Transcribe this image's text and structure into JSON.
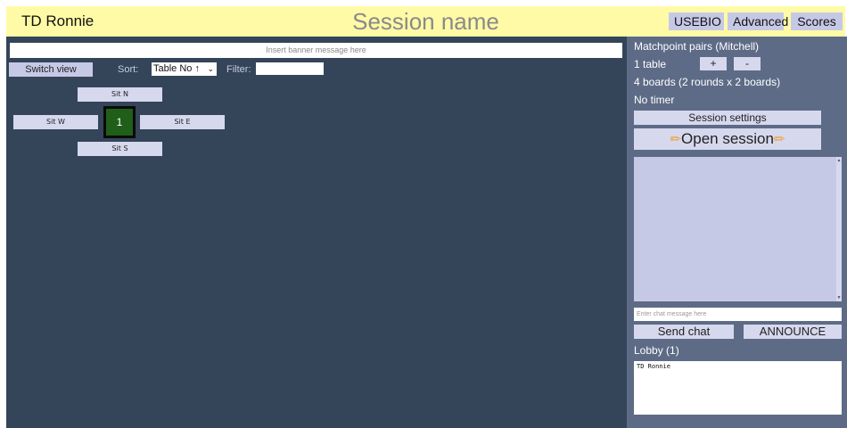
{
  "header": {
    "td_name": "TD Ronnie",
    "session_name": "Session name",
    "buttons": {
      "usebio": "USEBIO",
      "advanced": "Advanced",
      "scores": "Scores"
    }
  },
  "main": {
    "banner_placeholder": "Insert banner message here",
    "switch_view_label": "Switch view",
    "sort_label": "Sort:",
    "sort_value": "Table No ↑",
    "filter_label": "Filter:",
    "filter_value": "",
    "table": {
      "number": "1",
      "sit_n": "Sit N",
      "sit_w": "Sit W",
      "sit_e": "Sit E",
      "sit_s": "Sit S"
    }
  },
  "sidebar": {
    "movement": "Matchpoint pairs (Mitchell)",
    "tables": "1 table",
    "plus_label": "+",
    "minus_label": "-",
    "boards": "4 boards (2 rounds x 2 boards)",
    "timer": "No timer",
    "settings_label": "Session settings",
    "open_session_label": "Open session",
    "chat_placeholder": "Enter chat message here",
    "send_chat_label": "Send chat",
    "announce_label": "ANNOUNCE",
    "lobby_title": "Lobby (1)",
    "lobby_members": [
      "TD Ronnie"
    ]
  },
  "colors": {
    "header_bg": "#fffaa6",
    "main_bg": "#354559",
    "sidebar_bg": "#5d6b86",
    "button_bg": "#c6c9e6",
    "table_green": "#1f5f1a"
  }
}
